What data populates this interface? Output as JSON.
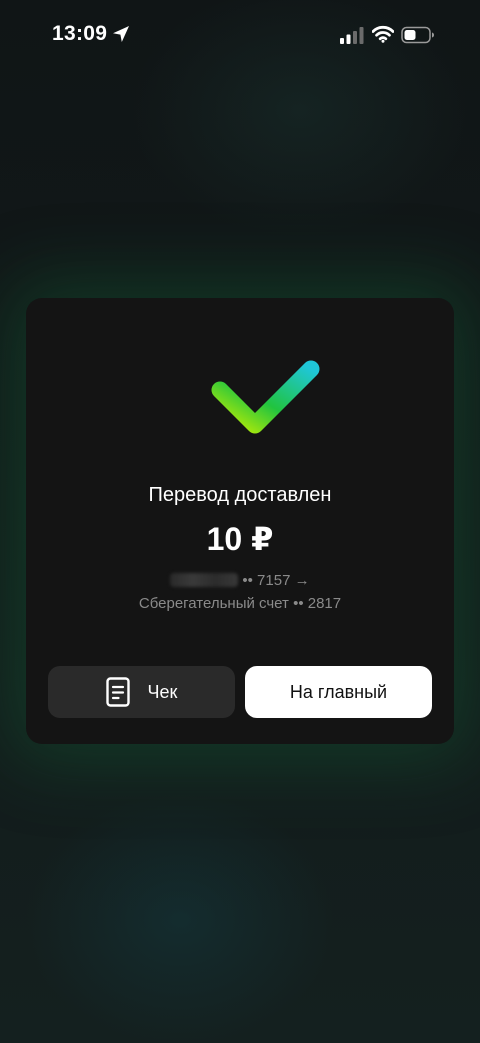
{
  "status_bar": {
    "time": "13:09",
    "location_icon": "location-arrow-icon",
    "signal_icon": "cellular-signal-icon",
    "wifi_icon": "wifi-icon",
    "battery_icon": "battery-icon"
  },
  "card": {
    "check_icon": "checkmark-icon",
    "title": "Перевод доставлен",
    "amount": "10 ₽",
    "from_account": "•• 7157 →",
    "to_account": "Сберегательный счет •• 2817",
    "receipt_button_label": "Чек",
    "receipt_icon": "receipt-icon",
    "home_button_label": "На главный"
  },
  "colors": {
    "check_gradient_start": "#c6f000",
    "check_gradient_mid": "#21c43f",
    "check_gradient_end": "#1fc6d8",
    "card_background": "#141414",
    "receipt_button_background": "#2a2a2a",
    "home_button_background": "#ffffff"
  }
}
